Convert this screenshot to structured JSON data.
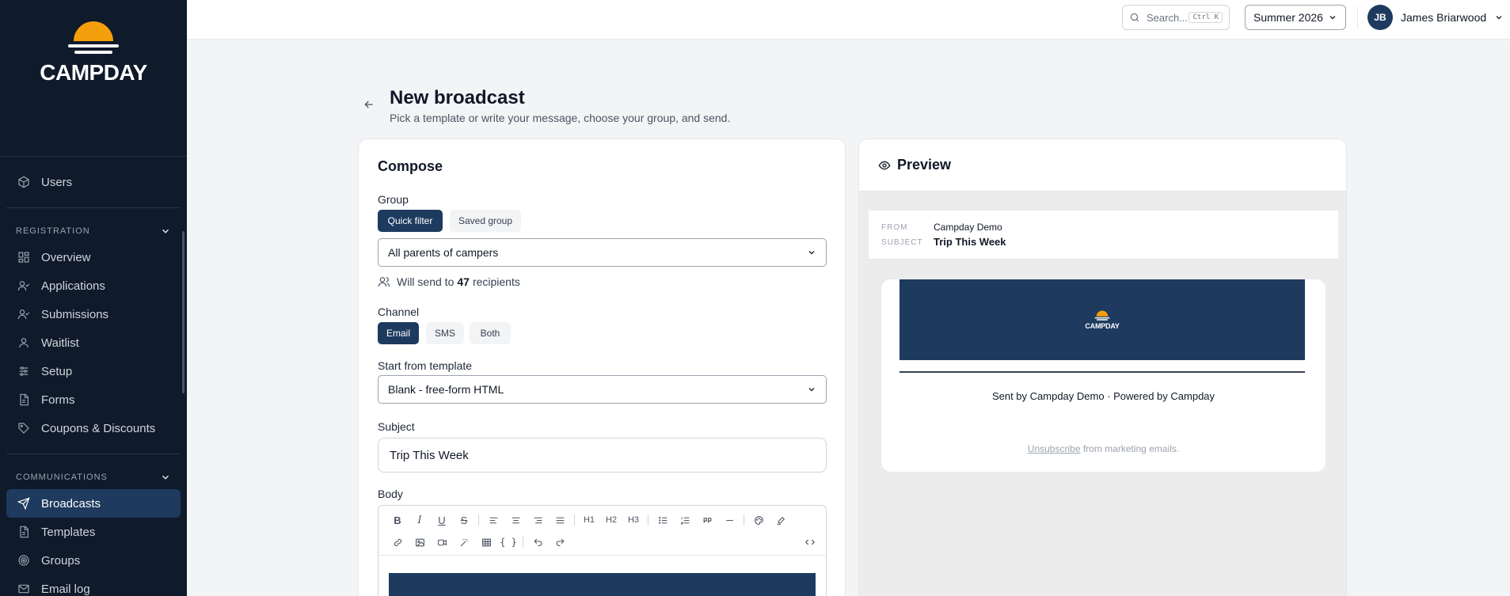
{
  "brand": {
    "name": "CAMPDAY",
    "accent": "#f59e0b",
    "navy": "#1e3a5f"
  },
  "sidebar": {
    "top_items": [
      {
        "label": "Users",
        "icon": "cube-icon"
      }
    ],
    "sections": [
      {
        "title": "REGISTRATION",
        "items": [
          {
            "label": "Overview",
            "icon": "grid-icon"
          },
          {
            "label": "Applications",
            "icon": "user-check-icon"
          },
          {
            "label": "Submissions",
            "icon": "user-check-icon"
          },
          {
            "label": "Waitlist",
            "icon": "user-icon"
          },
          {
            "label": "Setup",
            "icon": "sliders-icon"
          },
          {
            "label": "Forms",
            "icon": "document-icon"
          },
          {
            "label": "Coupons & Discounts",
            "icon": "tag-icon"
          }
        ]
      },
      {
        "title": "COMMUNICATIONS",
        "items": [
          {
            "label": "Broadcasts",
            "icon": "send-icon",
            "active": true
          },
          {
            "label": "Templates",
            "icon": "document-icon"
          },
          {
            "label": "Groups",
            "icon": "target-icon"
          },
          {
            "label": "Email log",
            "icon": "mail-icon"
          }
        ]
      }
    ]
  },
  "topbar": {
    "search_placeholder": "Search...",
    "shortcut": "Ctrl K",
    "season": "Summer 2026",
    "user_initials": "JB",
    "user_name": "James Briarwood"
  },
  "page": {
    "title": "New broadcast",
    "subtitle": "Pick a template or write your message, choose your group, and send."
  },
  "compose": {
    "title": "Compose",
    "group_label": "Group",
    "group_modes": [
      "Quick filter",
      "Saved group"
    ],
    "group_selected": "All parents of campers",
    "recipients_prefix": "Will send to",
    "recipients_count": "47",
    "recipients_suffix": "recipients",
    "channel_label": "Channel",
    "channels": [
      "Email",
      "SMS",
      "Both"
    ],
    "template_label": "Start from template",
    "template_selected": "Blank - free-form HTML",
    "subject_label": "Subject",
    "subject_value": "Trip This Week",
    "body_label": "Body",
    "toolbar_headings": [
      "H1",
      "H2",
      "H3"
    ]
  },
  "preview": {
    "title": "Preview",
    "from_key": "FROM",
    "from_value": "Campday Demo",
    "subject_key": "SUBJECT",
    "subject_value": "Trip This Week",
    "banner_text": "CAMPDAY",
    "footer": "Sent by Campday Demo · Powered by Campday",
    "unsubscribe_link": "Unsubscribe",
    "unsubscribe_suffix": " from marketing emails."
  }
}
